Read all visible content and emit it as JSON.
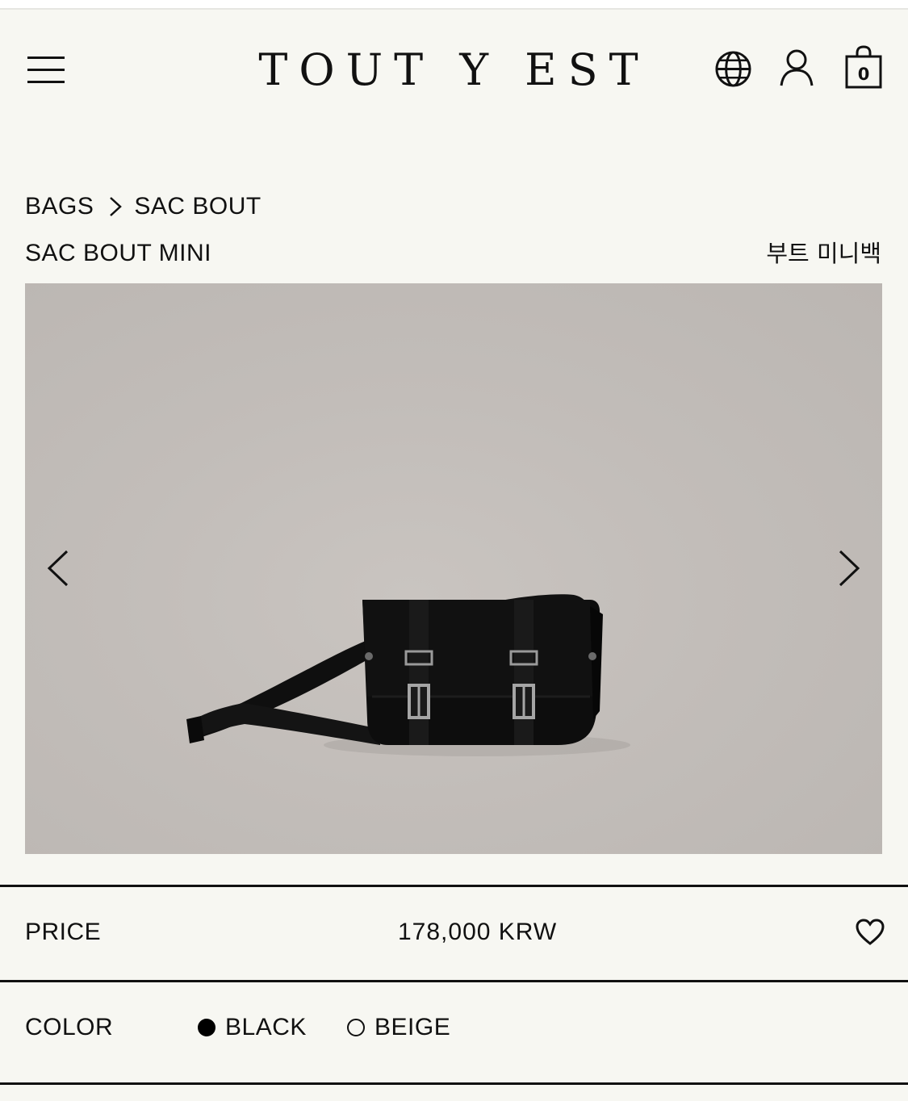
{
  "header": {
    "logo": "TOUT Y EST",
    "cart_count": "0"
  },
  "breadcrumb": {
    "items": [
      {
        "label": "BAGS"
      },
      {
        "label": "SAC BOUT"
      }
    ]
  },
  "product": {
    "title": "SAC BOUT MINI",
    "title_kr": "부트 미니백"
  },
  "price": {
    "label": "PRICE",
    "value": "178,000 KRW"
  },
  "color": {
    "label": "COLOR",
    "options": [
      {
        "label": "BLACK",
        "selected": true
      },
      {
        "label": "BEIGE",
        "selected": false
      }
    ]
  },
  "icons": {
    "menu": "menu-icon",
    "language": "globe-icon",
    "account": "user-icon",
    "cart": "shopping-bag-icon",
    "wishlist": "heart-icon",
    "prev": "chevron-left-icon",
    "next": "chevron-right-icon"
  },
  "colors": {
    "background": "#f7f7f2",
    "text": "#111111",
    "photo_background": "#c3beba",
    "bag": "#0c0c0c"
  }
}
